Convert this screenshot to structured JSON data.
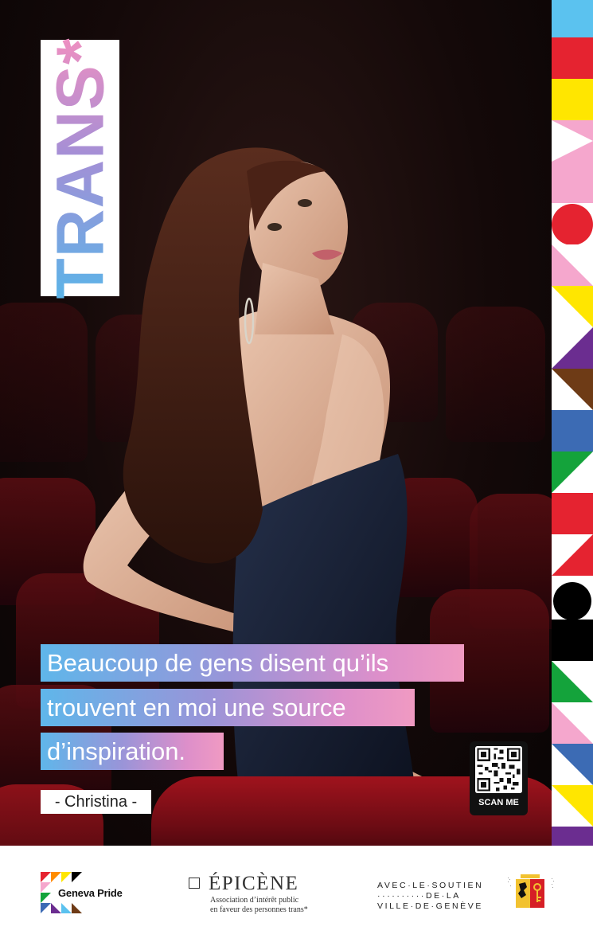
{
  "label": {
    "text": "TRANS*"
  },
  "quote": {
    "line1": "Beaucoup de gens disent qu’ils",
    "line2": "trouvent en moi une source",
    "line3": "d’inspiration."
  },
  "author": "- Christina -",
  "qr": {
    "label": "SCAN ME"
  },
  "footer": {
    "geneva_pride": "Geneva Pride",
    "epicene": {
      "title": "ÉPICÈNE",
      "subtitle_line1": "Association d’intérêt public",
      "subtitle_line2": "en faveur des personnes trans*"
    },
    "ville": {
      "line1": "AVEC·LE·SOUTIEN",
      "line2": "··········DE·LA",
      "line3": "VILLE·DE·GENÈVE"
    }
  },
  "icons": {
    "qr": "qr-code-icon",
    "crest": "geneva-crest-icon",
    "gp_logo": "geneva-pride-logo-icon",
    "ep_logo": "epicene-square-icon"
  },
  "colors": {
    "gradient_start": "#5fb6ea",
    "gradient_end": "#f09ac2",
    "seat_red": "#a0131d",
    "strip_blue": "#5bc2ef",
    "strip_red": "#e52330",
    "strip_yellow": "#ffe600",
    "strip_pink": "#f5a7cd",
    "strip_purple": "#6b2d90",
    "strip_brown": "#6e3b16",
    "strip_navy": "#3c6bb4",
    "strip_green": "#14a33b"
  }
}
